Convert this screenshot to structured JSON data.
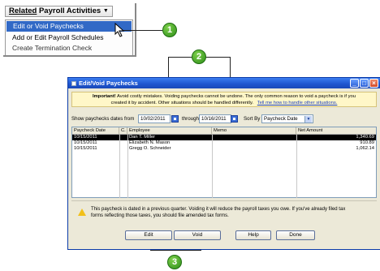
{
  "menu": {
    "header_underlined": "Related",
    "header_rest": " Payroll Activities",
    "items": [
      "Edit or Void Paychecks",
      "Add or Edit Payroll Schedules",
      "Create Termination Check"
    ]
  },
  "callouts": [
    "1",
    "2",
    "3"
  ],
  "dialog": {
    "title": "Edit/Void Paychecks",
    "banner": {
      "important": "Important!",
      "text1": " Avoid costly mistakes. Voiding paychecks cannot be undone. The only common reason to void a paycheck is if you",
      "text2": "created it by accident. Other situations should be handled differently.",
      "link": "Tell me how to handle other situations."
    },
    "filter": {
      "label": "Show paychecks dates from",
      "from": "10/02/2011",
      "through_label": "through",
      "through": "10/16/2011",
      "sort_label": "Sort By",
      "sort_value": "Paycheck Date"
    },
    "table": {
      "headers": [
        "Paycheck Date",
        "C.",
        "Employee",
        "Memo",
        "Net Amount"
      ],
      "rows": [
        {
          "date": "10/15/2011",
          "c": "",
          "employee": "Dan T. Miller",
          "memo": "",
          "amount": "1,340.69"
        },
        {
          "date": "10/15/2011",
          "c": "",
          "employee": "Elizabeth N. Mason",
          "memo": "",
          "amount": "910.89"
        },
        {
          "date": "10/15/2011",
          "c": "",
          "employee": "Gregg O. Schneider",
          "memo": "",
          "amount": "1,062.14"
        }
      ]
    },
    "warning": {
      "line1": "This paycheck is dated in a previous quarter. Voiding it will reduce the payroll taxes you owe. If you've already filed tax",
      "line2": "forms reflecting those taxes, you should file amended tax forms."
    },
    "buttons": {
      "edit": "Edit",
      "void": "Void",
      "help": "Help",
      "done": "Done"
    }
  }
}
